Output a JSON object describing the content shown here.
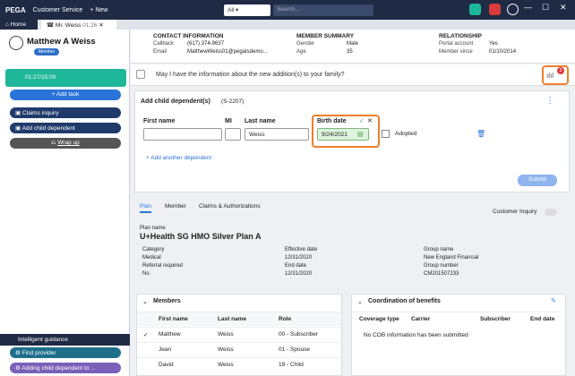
{
  "topbar": {
    "logo": "PEGA",
    "app": "Customer Service",
    "new": "+ New",
    "scope": "All",
    "search_placeholder": "Search..."
  },
  "tabs": {
    "home": "Home",
    "case": "Mr. Weiss",
    "case_time": "01:26"
  },
  "member": {
    "name": "Matthew A Weiss",
    "badge": "Member",
    "timer": "01:27/15:00"
  },
  "actions": {
    "add_task": "+ Add task",
    "claims_inquiry": "Claims inquiry",
    "add_child": "Add child dependent",
    "wrap_up": "Wrap up"
  },
  "guidance": {
    "title": "Intelligent guidance",
    "find_provider": "Find provider",
    "adding_child": "Adding child dependent to ..."
  },
  "contact": {
    "title": "CONTACT INFORMATION",
    "callback_label": "Callback",
    "callback": "(617) 374-9637",
    "email_label": "Email",
    "email": "MatthewWeiss01@pegatsdemo..."
  },
  "summary": {
    "title": "MEMBER SUMMARY",
    "gender_label": "Gender",
    "gender": "Male",
    "age_label": "Age",
    "age": "35"
  },
  "relationship": {
    "title": "RELATIONSHIP",
    "portal_label": "Portal account",
    "portal": "Yes",
    "since_label": "Member since",
    "since": "01/10/2014"
  },
  "question": "May I have the information about the new addition(s) to your family?",
  "notif_count": "3",
  "form": {
    "title": "Add child dependent(s)",
    "case_id": "(S-2207)",
    "first_name_label": "First name",
    "mi_label": "MI",
    "last_name_label": "Last name",
    "birth_label": "Birth date",
    "first_name": "",
    "mi": "",
    "last_name": "Weiss",
    "birth": "9/24/2021",
    "adopted_label": "Adopted",
    "add_another": "+ Add another dependent",
    "submit": "Submit"
  },
  "subtabs": [
    "Plan",
    "Member",
    "Claims & Authorizations"
  ],
  "customer_inquiry": "Customer Inquiry",
  "plan": {
    "name_label": "Plan name",
    "name": "U+Health SG HMO Silver Plan A",
    "category_label": "Category",
    "category": "Medical",
    "referral_label": "Referral required",
    "referral": "No",
    "eff_label": "Effective date",
    "eff": "12/31/2020",
    "end_label": "End date",
    "end": "12/31/2020",
    "group_label": "Group name",
    "group": "New England Financial",
    "groupnum_label": "Group number",
    "groupnum": "CM201507233"
  },
  "members": {
    "title": "Members",
    "cols": [
      "First name",
      "Last name",
      "Role"
    ],
    "rows": [
      {
        "first": "Matthew",
        "last": "Weiss",
        "role": "00 - Subscriber"
      },
      {
        "first": "Jean",
        "last": "Weiss",
        "role": "01 - Spouse"
      },
      {
        "first": "David",
        "last": "Weiss",
        "role": "19 - Child"
      }
    ]
  },
  "cob": {
    "title": "Coordination of benefits",
    "cols": [
      "Coverage type",
      "Carrier",
      "Subscriber",
      "End date"
    ],
    "empty": "No COB information has been submitted"
  },
  "colors": {
    "topbar": "#1f2a44",
    "accent": "#2a74d9",
    "teal": "#1fb79a",
    "highlight": "#ef7f2d"
  }
}
